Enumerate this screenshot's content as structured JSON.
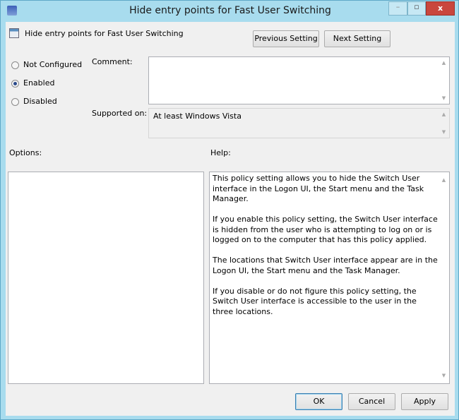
{
  "window": {
    "title": "Hide entry points for Fast User Switching",
    "minimize": "–",
    "maximize": "▫",
    "close": "x"
  },
  "header": {
    "setting_name": "Hide entry points for Fast User Switching",
    "previous_label": "Previous Setting",
    "next_label": "Next Setting"
  },
  "state": {
    "options": [
      {
        "label": "Not Configured",
        "selected": false
      },
      {
        "label": "Enabled",
        "selected": true
      },
      {
        "label": "Disabled",
        "selected": false
      }
    ]
  },
  "comment": {
    "label": "Comment:",
    "value": ""
  },
  "supported": {
    "label": "Supported on:",
    "value": "At least Windows Vista"
  },
  "options_label": "Options:",
  "help": {
    "label": "Help:",
    "paragraphs": [
      "This policy setting allows you to hide the Switch User interface in the Logon UI, the Start menu and the Task Manager.",
      "If you enable this policy setting, the Switch User interface is hidden from the user who is attempting to log on or is logged on to the computer that has this policy applied.",
      "The locations that Switch User interface appear are in the Logon UI, the Start menu and the Task Manager.",
      "If you disable or do not figure this policy setting, the Switch User interface is accessible to the user in the three locations."
    ]
  },
  "footer": {
    "ok": "OK",
    "cancel": "Cancel",
    "apply": "Apply"
  }
}
